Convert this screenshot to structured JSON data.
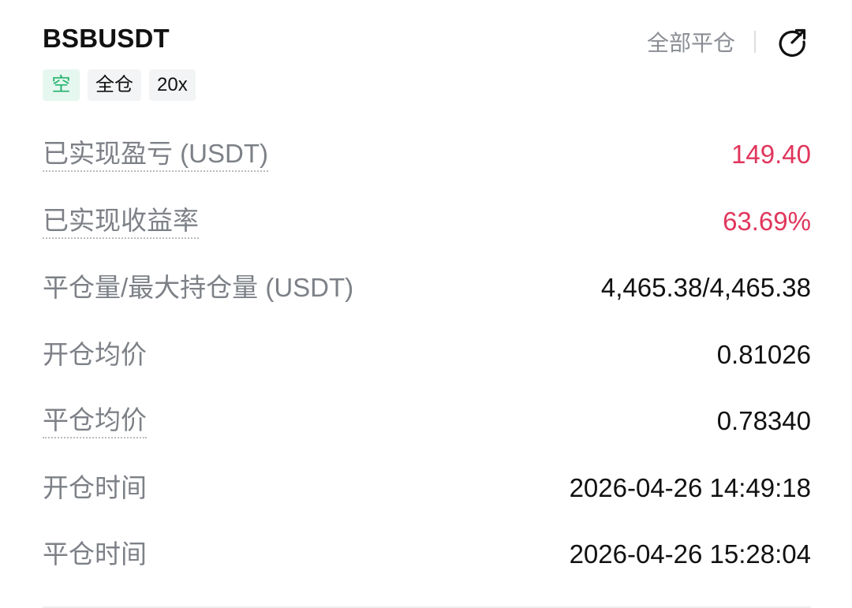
{
  "position": {
    "symbol": "BSBUSDT",
    "tags": {
      "side": "空",
      "margin_mode": "全仓",
      "leverage": "20x"
    }
  },
  "actions": {
    "close_all_label": "全部平仓",
    "share_icon": "share-arrow-icon"
  },
  "details": [
    {
      "label": "已实现盈亏 (USDT)",
      "value": "149.40"
    },
    {
      "label": "已实现收益率",
      "value": "63.69%"
    },
    {
      "label": "平仓量/最大持仓量 (USDT)",
      "value": "4,465.38/4,465.38"
    },
    {
      "label": "开仓均价",
      "value": "0.81026"
    },
    {
      "label": "平仓均价",
      "value": "0.78340"
    },
    {
      "label": "开仓时间",
      "value": "2026-04-26 14:49:18"
    },
    {
      "label": "平仓时间",
      "value": "2026-04-26 15:28:04"
    }
  ],
  "colors": {
    "profit": "#e0365c",
    "short_tag_text": "#20b26c",
    "short_tag_bg": "#e6f7ef",
    "muted": "#7d8187"
  }
}
